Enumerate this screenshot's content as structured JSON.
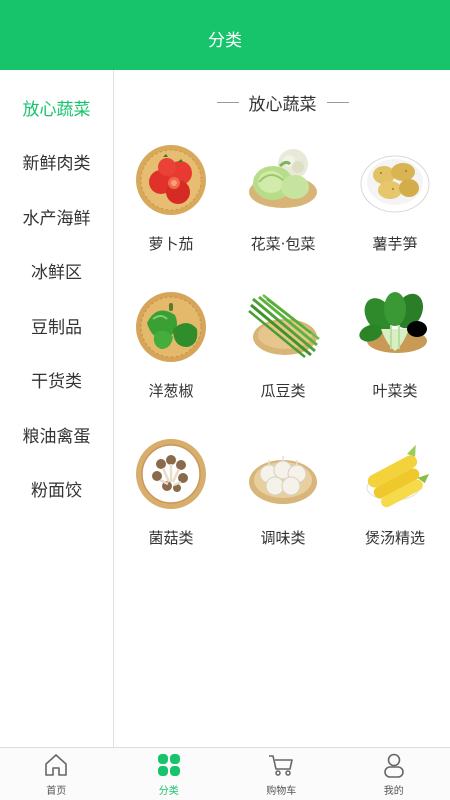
{
  "header": {
    "title": "分类"
  },
  "sidebar": {
    "items": [
      {
        "label": "放心蔬菜",
        "active": true
      },
      {
        "label": "新鲜肉类"
      },
      {
        "label": "水产海鲜"
      },
      {
        "label": "冰鲜区"
      },
      {
        "label": "豆制品"
      },
      {
        "label": "干货类"
      },
      {
        "label": "粮油禽蛋"
      },
      {
        "label": "粉面饺"
      }
    ]
  },
  "section": {
    "title": "放心蔬菜",
    "items": [
      {
        "label": "萝卜茄",
        "icon": "tomato-image"
      },
      {
        "label": "花菜·包菜",
        "icon": "cabbage-image"
      },
      {
        "label": "薯芋笋",
        "icon": "potato-image"
      },
      {
        "label": "洋葱椒",
        "icon": "pepper-image"
      },
      {
        "label": "瓜豆类",
        "icon": "beans-image"
      },
      {
        "label": "叶菜类",
        "icon": "leafy-greens-image"
      },
      {
        "label": "菌菇类",
        "icon": "mushroom-image"
      },
      {
        "label": "调味类",
        "icon": "garlic-image"
      },
      {
        "label": "煲汤精选",
        "icon": "corn-image"
      }
    ]
  },
  "tabbar": {
    "tabs": [
      {
        "label": "首页",
        "icon": "home-icon"
      },
      {
        "label": "分类",
        "icon": "category-icon",
        "active": true
      },
      {
        "label": "购物车",
        "icon": "cart-icon"
      },
      {
        "label": "我的",
        "icon": "user-icon"
      }
    ]
  },
  "colors": {
    "accent": "#17c46b",
    "text": "#333333",
    "divider": "#e2e2e2"
  }
}
